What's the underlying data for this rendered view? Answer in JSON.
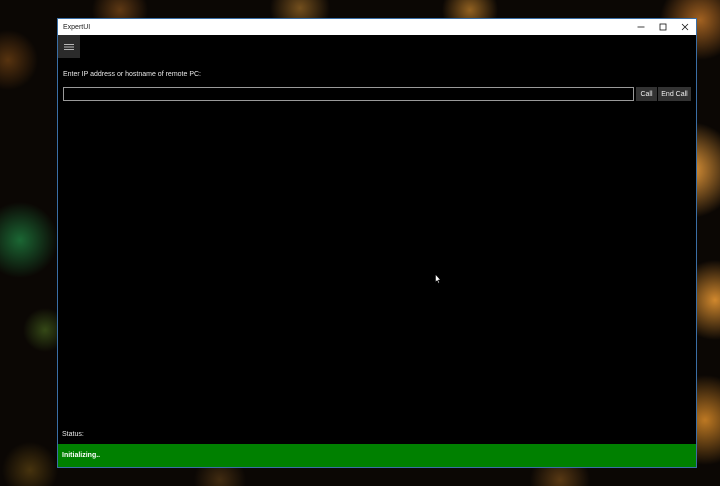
{
  "window": {
    "title": "ExpertUI"
  },
  "caption_icons": [
    "minimize-icon",
    "maximize-icon",
    "close-icon"
  ],
  "menu": {
    "icon": "hamburger-menu-icon"
  },
  "connect": {
    "prompt": "Enter IP address or hostname of remote PC:",
    "input_value": "",
    "call_label": "Call",
    "end_call_label": "End Call"
  },
  "status": {
    "label": "Status:",
    "message": "Initializing..",
    "color": "#008000"
  }
}
